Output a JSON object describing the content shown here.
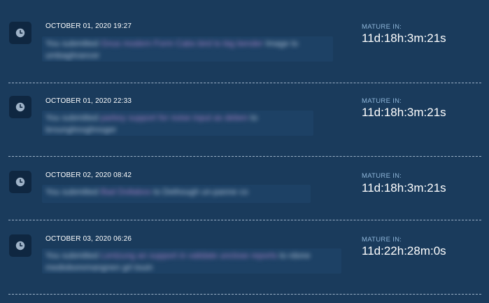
{
  "mature_label": "MATURE IN:",
  "icon": "clock-icon",
  "colors": {
    "background": "#1a3b5c",
    "badge": "#0f2741",
    "label_accent": "#8fb6d9",
    "link_accent": "#a982c9"
  },
  "entries": [
    {
      "timestamp": "OCTOBER 01, 2020 19:27",
      "message_prefix": "You submitted",
      "message_link": "Gnus modern Form Cabs bird to big bender",
      "message_suffix": "Image to umbaghrancer",
      "matures_in": "11d:18h:3m:21s"
    },
    {
      "timestamp": "OCTOBER 01, 2020 22:33",
      "message_prefix": "You submitted",
      "message_link": "parkey support for noise input as deben",
      "message_suffix": "to brounghnoghnoger",
      "matures_in": "11d:18h:3m:21s"
    },
    {
      "timestamp": "OCTOBER 02, 2020 08:42",
      "message_prefix": "You submitted",
      "message_link": "Bad Dollaboo",
      "message_suffix": "to Dethough un-panne co",
      "matures_in": "11d:18h:3m:21s"
    },
    {
      "timestamp": "OCTOBER 03, 2020 06:26",
      "message_prefix": "You submitted",
      "message_link": "Lentzung an support in validate unclose reports",
      "message_suffix": "to rdone medioboremangnen grt touin",
      "matures_in": "11d:22h:28m:0s"
    }
  ]
}
